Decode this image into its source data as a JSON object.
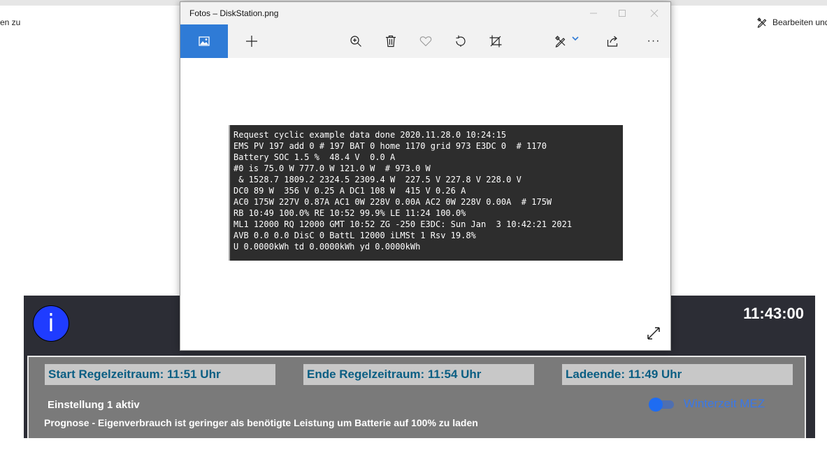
{
  "background_app": {
    "left_text": "en zu",
    "edit_label": "Bearbeiten und",
    "info_label": "i",
    "clock": "11:43:00",
    "start_label": "Start Regelzeitraum: 11:51 Uhr",
    "end_label": "Ende Regelzeitraum: 11:54 Uhr",
    "charge_end_label": "Ladeende: 11:49 Uhr",
    "setting_label": "Einstellung 1 aktiv",
    "prognose_text": "Prognose - Eigenverbrauch ist geringer als benötigte Leistung um Batterie auf 100% zu laden",
    "toggle_label": "Winterzeit MEZ"
  },
  "photos_window": {
    "title": "Fotos –  DiskStation.png",
    "toolbar": {
      "icons": [
        "image-icon",
        "plus-icon",
        "zoom-in-icon",
        "trash-icon",
        "heart-icon",
        "rotate-icon",
        "crop-icon",
        "edit-icon",
        "chevron-down-icon",
        "share-icon",
        "more-icon"
      ],
      "more_label": "···"
    },
    "image_text_lines": [
      "Request cyclic example data done 2020.11.28.0 10:24:15",
      "EMS PV 197 add 0 # 197 BAT 0 home 1170 grid 973 E3DC 0  # 1170",
      "Battery SOC 1.5 %  48.4 V  0.0 A",
      "#0 is 75.0 W 777.0 W 121.0 W  # 973.0 W",
      " & 1528.7 1809.2 2324.5 2309.4 W  227.5 V 227.8 V 228.0 V",
      "DC0 89 W  356 V 0.25 A DC1 108 W  415 V 0.26 A",
      "AC0 175W 227V 0.87A AC1 0W 228V 0.00A AC2 0W 228V 0.00A  # 175W",
      "RB 10:49 100.0% RE 10:52 99.9% LE 11:24 100.0%",
      "ML1 12000 RQ 12000 GMT 10:52 ZG -250 E3DC: Sun Jan  3 10:42:21 2021",
      "AVB 0.0 0.0 DisC 0 BattL 12000 iLMSt 1 Rsv 19.8%",
      "U 0.0000kWh td 0.0000kWh yd 0.0000kWh"
    ]
  },
  "colors": {
    "accent": "#2f7bd6",
    "panel_text": "#0a5e83",
    "info_blue": "#1f3cff",
    "toggle_blue": "#1e6cf2"
  }
}
